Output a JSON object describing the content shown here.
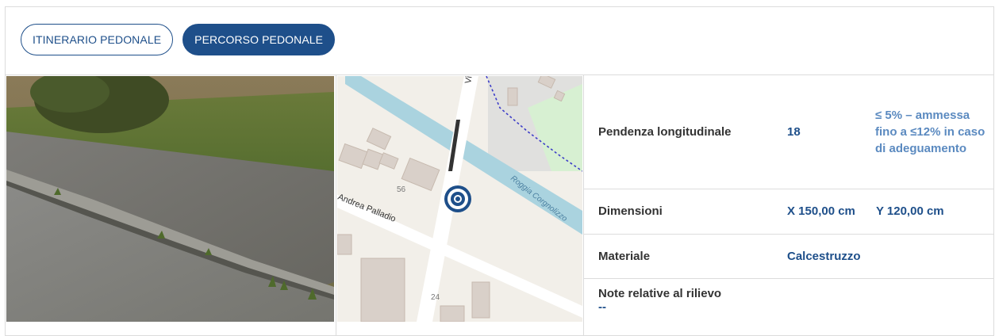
{
  "tabs": [
    {
      "label": "ITINERARIO PEDONALE",
      "active": false
    },
    {
      "label": "PERCORSO PEDONALE",
      "active": true
    }
  ],
  "photo": {
    "alt": "road-ramp-photo"
  },
  "map": {
    "street_label": "Andrea Palladio",
    "canal_label": "Roggia Corgnolizzo",
    "road_label_partial": "Vi",
    "house_numbers": [
      "56",
      "24"
    ],
    "marker": "target-marker-icon"
  },
  "table": {
    "pendenza": {
      "label": "Pendenza longitudinale",
      "value": "18",
      "note": "≤ 5% – ammessa fino a ≤12% in caso di adeguamento"
    },
    "dimensioni": {
      "label": "Dimensioni",
      "x": "X 150,00 cm",
      "y": "Y 120,00 cm"
    },
    "materiale": {
      "label": "Materiale",
      "value": "Calcestruzzo"
    },
    "note": {
      "label": "Note relative al rilievo",
      "value": "--"
    }
  },
  "colors": {
    "accent": "#1e4f8a",
    "accent_light": "#5b8ac0",
    "border": "#dcdcdc"
  }
}
